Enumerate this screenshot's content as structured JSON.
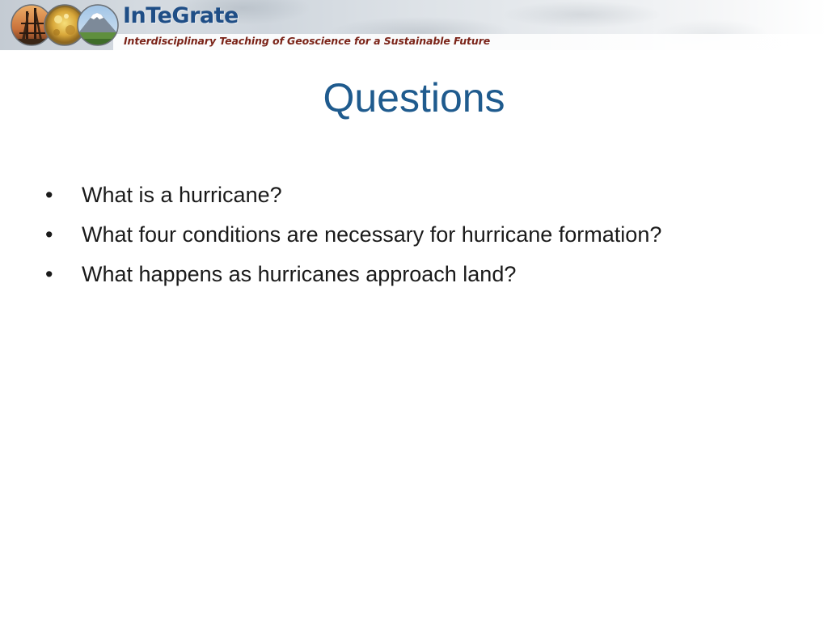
{
  "header": {
    "brand_title": "InTeGrate",
    "brand_subtitle": "Interdisciplinary Teaching of Geoscience for a Sustainable Future",
    "logo_icons": [
      "oil-derrick-icon",
      "gold-nugget-icon",
      "volcano-landscape-icon"
    ],
    "colors": {
      "brand_title": "#1f4e86",
      "brand_subtitle": "#7a2318"
    }
  },
  "slide": {
    "title": "Questions",
    "title_color": "#1f5b8e",
    "bullet_glyph": "•",
    "bullets": [
      "What is a hurricane?",
      "What four conditions are necessary for hurricane formation?",
      "What happens as hurricanes approach land?"
    ]
  }
}
